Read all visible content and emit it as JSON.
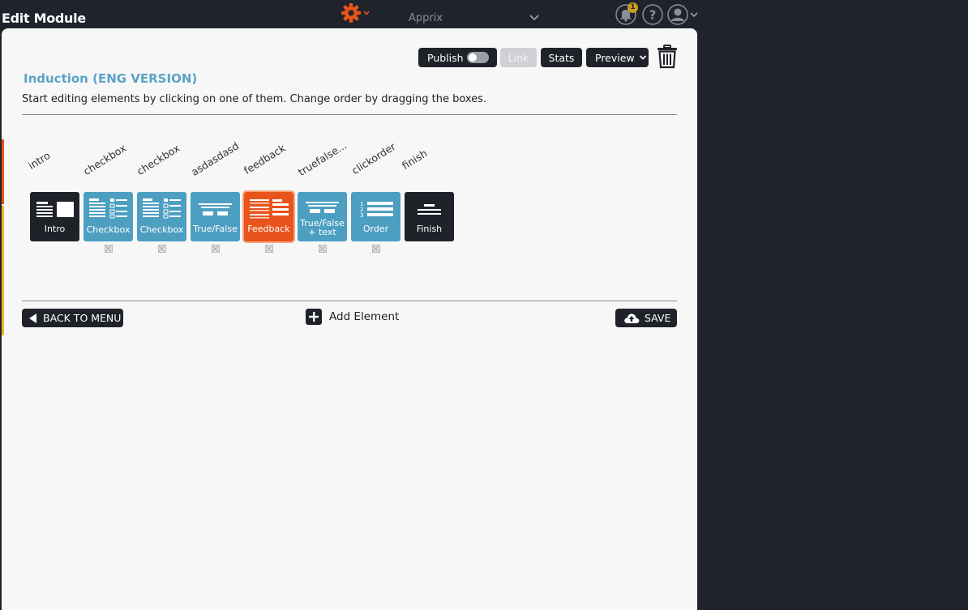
{
  "header": {
    "title": "Edit Module",
    "organization": "Apprix",
    "notification_count": "1"
  },
  "toolbar": {
    "publish_label": "Publish",
    "link_label": "Link",
    "stats_label": "Stats",
    "preview_label": "Preview"
  },
  "module": {
    "title": "Induction (ENG VERSION)",
    "instructions": "Start editing elements by clicking on one of them. Change order by dragging the boxes."
  },
  "elements": [
    {
      "name": "intro",
      "caption": "Intro",
      "type": "intro"
    },
    {
      "name": "checkbox",
      "caption": "Checkbox",
      "type": "checkbox"
    },
    {
      "name": "checkbox",
      "caption": "Checkbox",
      "type": "checkbox"
    },
    {
      "name": "asdasdasd",
      "caption": "True/False",
      "type": "truefalse"
    },
    {
      "name": "feedback",
      "caption": "Feedback",
      "type": "feedback"
    },
    {
      "name": "truefalse...",
      "caption_line1": "True/False",
      "caption_line2": "+ text",
      "type": "truefalse-text"
    },
    {
      "name": "clickorder",
      "caption": "Order",
      "type": "order"
    },
    {
      "name": "finish",
      "caption": "Finish",
      "type": "finish"
    }
  ],
  "footer": {
    "back_label": "BACK TO MENU",
    "add_label": "Add Element",
    "save_label": "SAVE"
  },
  "colors": {
    "background": "#1f232b",
    "accent_orange": "#e8541c",
    "tile_blue": "#4d9fc1",
    "title_blue": "#5aa3c7",
    "dark": "#1f2329"
  }
}
